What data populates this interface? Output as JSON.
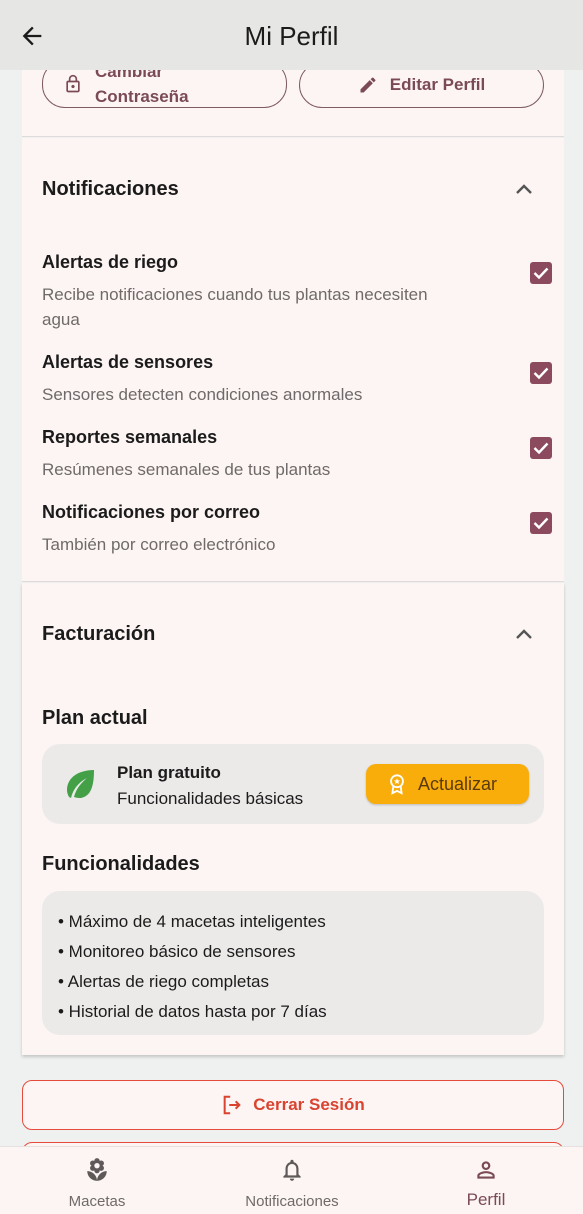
{
  "appbar": {
    "title": "Mi Perfil",
    "back_icon": "arrow-left-icon"
  },
  "profile_actions": {
    "change_password_label": "Cambiar\nContraseña",
    "edit_profile_label": "Editar Perfil"
  },
  "notifications": {
    "title": "Notificaciones",
    "items": [
      {
        "title": "Alertas de riego",
        "description": "Recibe notificaciones cuando tus plantas necesiten agua",
        "checked": true
      },
      {
        "title": "Alertas de sensores",
        "description": "Sensores detecten condiciones anormales",
        "checked": true
      },
      {
        "title": "Reportes semanales",
        "description": "Resúmenes semanales de tus plantas",
        "checked": true
      },
      {
        "title": "Notificaciones por correo",
        "description": "También por correo electrónico",
        "checked": true
      }
    ]
  },
  "billing": {
    "title": "Facturación",
    "current_plan_heading": "Plan actual",
    "plan_name": "Plan gratuito",
    "plan_description": "Funcionalidades básicas",
    "upgrade_label": "Actualizar",
    "features_heading": "Funcionalidades",
    "features": [
      "• Máximo de 4 macetas inteligentes",
      "• Monitoreo básico de sensores",
      "• Alertas de riego completas",
      "• Historial de datos hasta por 7 días"
    ]
  },
  "logout_label": "Cerrar Sesión",
  "bottom_nav": {
    "items": [
      {
        "label": "Macetas",
        "icon": "flower-icon",
        "active": false
      },
      {
        "label": "Notificaciones",
        "icon": "bell-icon",
        "active": false
      },
      {
        "label": "Perfil",
        "icon": "person-icon",
        "active": true
      }
    ]
  },
  "colors": {
    "accent": "#8c4a5e",
    "upgrade": "#f9ad0b",
    "danger": "#e64a3a",
    "leaf": "#43a047"
  }
}
